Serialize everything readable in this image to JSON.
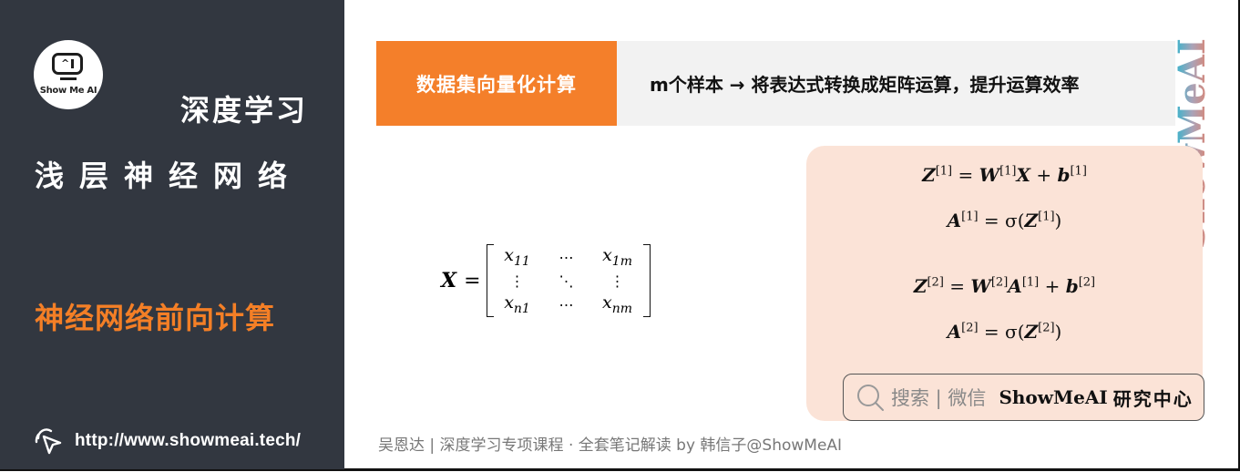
{
  "sidebar": {
    "logo_text": "Show Me AI",
    "course_title": "深度学习",
    "chapter_title": "浅层神经网络",
    "section_title": "神经网络前向计算",
    "url": "http://www.showmeai.tech/",
    "url_icon": "cursor-click-icon"
  },
  "topic": {
    "label": "数据集向量化计算",
    "description": "m个样本 → 将表达式转换成矩阵运算，提升运算效率"
  },
  "watermark": {
    "text": "ShowMeAI"
  },
  "matrix": {
    "lhs": "X",
    "equals": "=",
    "cells": [
      {
        "base": "x",
        "sub": "11"
      },
      {
        "dots": "⋯"
      },
      {
        "base": "x",
        "sub": "1m"
      },
      {
        "dots": "⋮"
      },
      {
        "dots": "⋱"
      },
      {
        "dots": "⋮"
      },
      {
        "base": "x",
        "sub": "n1"
      },
      {
        "dots": "⋯"
      },
      {
        "base": "x",
        "sub": "nm"
      }
    ]
  },
  "formulas": {
    "f1": {
      "lhs": "Z",
      "lhs_sup": "[1]",
      "eq": " = ",
      "t1": "W",
      "t1_sup": "[1]",
      "t2": "X",
      "plus": " + ",
      "t3": "b",
      "t3_sup": "[1]"
    },
    "f2": {
      "lhs": "A",
      "lhs_sup": "[1]",
      "eq": " = σ(",
      "t1": "Z",
      "t1_sup": "[1]",
      "close": ")"
    },
    "f3": {
      "lhs": "Z",
      "lhs_sup": "[2]",
      "eq": " = ",
      "t1": "W",
      "t1_sup": "[2]",
      "t2": "A",
      "t2_sup": "[1]",
      "plus": " + ",
      "t3": "b",
      "t3_sup": "[2]"
    },
    "f4": {
      "lhs": "A",
      "lhs_sup": "[2]",
      "eq": " = σ(",
      "t1": "Z",
      "t1_sup": "[2]",
      "close": ")"
    }
  },
  "search_badge": {
    "hint": "搜索 | 微信",
    "brand": "ShowMeAI",
    "center": "研究中心",
    "icon": "search-icon"
  },
  "footer": {
    "credit": "吴恩达 | 深度学习专项课程 · 全套笔记解读  by 韩信子@ShowMeAI"
  }
}
